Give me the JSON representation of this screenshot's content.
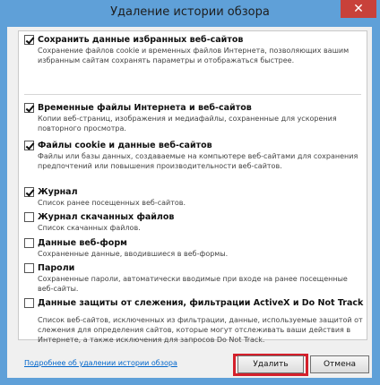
{
  "window": {
    "title": "Удаление истории обзора",
    "close_glyph": "✕"
  },
  "options": [
    {
      "label": "Сохранить данные избранных веб-сайтов",
      "description": "Сохранение файлов cookie и временных файлов Интернета, позволяющих вашим избранным сайтам сохранять параметры и отображаться быстрее.",
      "checked": true
    },
    {
      "label": "Временные файлы Интернета и веб-сайтов",
      "description": "Копии веб-страниц, изображения и медиафайлы, сохраненные для ускорения повторного просмотра.",
      "checked": true
    },
    {
      "label": "Файлы cookie и данные веб-сайтов",
      "description": "Файлы или базы данных, создаваемые на компьютере веб-сайтами для сохранения предпочтений или повышения производительности веб-сайтов.",
      "checked": true
    },
    {
      "label": "Журнал",
      "description": "Список ранее посещенных веб-сайтов.",
      "checked": true
    },
    {
      "label": "Журнал скачанных файлов",
      "description": "Список скачанных файлов.",
      "checked": false
    },
    {
      "label": "Данные веб-форм",
      "description": "Сохраненные данные, вводившиеся в веб-формы.",
      "checked": false
    },
    {
      "label": "Пароли",
      "description": "Сохраненные пароли, автоматически вводимые при входе на ранее посещенные веб-сайты.",
      "checked": false
    },
    {
      "label": "Данные защиты от слежения, фильтрации ActiveX и Do Not Track",
      "description": "Список веб-сайтов, исключенных из фильтрации, данные, используемые защитой от слежения для определения сайтов, которые могут отслеживать ваши действия в Интернете, а также исключения для запросов Do Not Track.",
      "checked": false
    }
  ],
  "footer": {
    "link": "Подробнее об удалении истории обзора",
    "delete_label": "Удалить",
    "cancel_label": "Отмена"
  },
  "colors": {
    "frame": "#5fa0d8",
    "close": "#c8413a",
    "highlight": "#d4202b",
    "link": "#0066cc"
  }
}
